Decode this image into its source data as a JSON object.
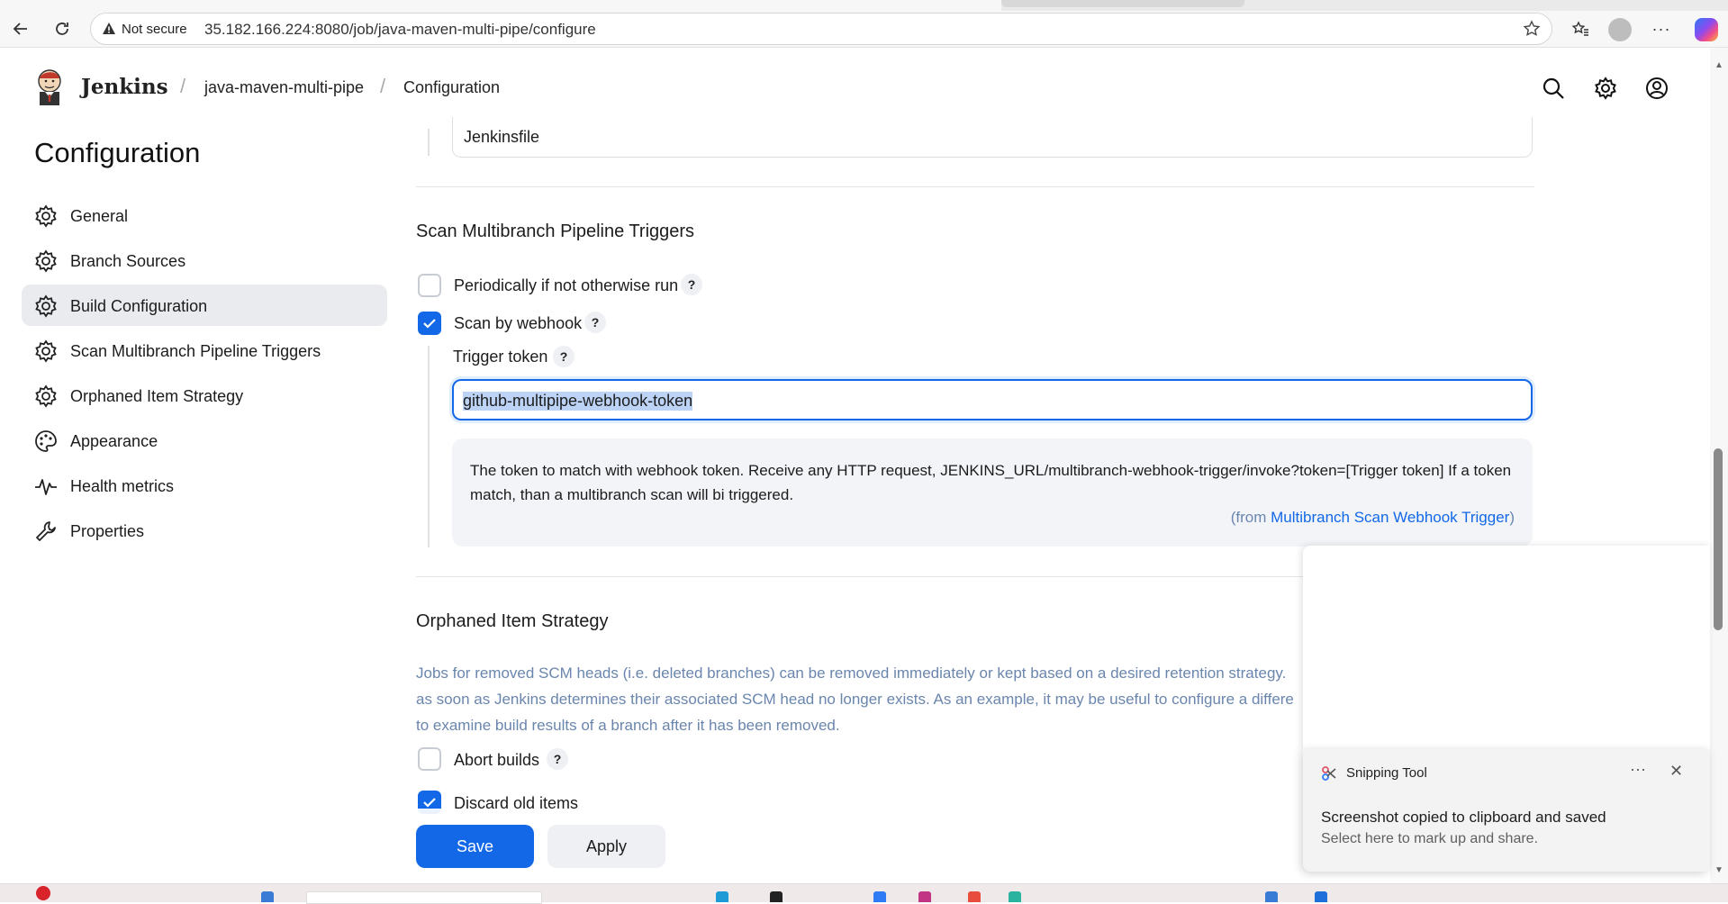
{
  "browser": {
    "security_label": "Not secure",
    "url": "35.182.166.224:8080/job/java-maven-multi-pipe/configure"
  },
  "header": {
    "brand": "Jenkins",
    "breadcrumbs": [
      "java-maven-multi-pipe",
      "Configuration"
    ]
  },
  "sidebar": {
    "title": "Configuration",
    "items": [
      {
        "label": "General",
        "icon": "gear-icon"
      },
      {
        "label": "Branch Sources",
        "icon": "gear-icon"
      },
      {
        "label": "Build Configuration",
        "icon": "gear-icon",
        "active": true
      },
      {
        "label": "Scan Multibranch Pipeline Triggers",
        "icon": "gear-icon"
      },
      {
        "label": "Orphaned Item Strategy",
        "icon": "gear-icon"
      },
      {
        "label": "Appearance",
        "icon": "palette-icon"
      },
      {
        "label": "Health metrics",
        "icon": "pulse-icon"
      },
      {
        "label": "Properties",
        "icon": "wrench-icon"
      }
    ]
  },
  "main": {
    "script_path_value": "Jenkinsfile",
    "triggers": {
      "title": "Scan Multibranch Pipeline Triggers",
      "periodic_label": "Periodically if not otherwise run",
      "periodic_checked": false,
      "webhook_label": "Scan by webhook",
      "webhook_checked": true,
      "token_label": "Trigger token",
      "token_value": "github-multipipe-webhook-token",
      "help_text": "The token to match with webhook token. Receive any HTTP request, JENKINS_URL/multibranch-webhook-trigger/invoke?token=[Trigger token] If a token match, than a multibranch scan will bi triggered.",
      "help_from_prefix": "(from ",
      "help_from_link": "Multibranch Scan Webhook Trigger",
      "help_from_suffix": ")"
    },
    "orphaned": {
      "title": "Orphaned Item Strategy",
      "desc_lines": [
        "Jobs for removed SCM heads (i.e. deleted branches) can be removed immediately or kept based on a desired retention strategy.",
        "as soon as Jenkins determines their associated SCM head no longer exists. As an example, it may be useful to configure a differe",
        "to examine build results of a branch after it has been removed."
      ],
      "abort_label": "Abort builds",
      "abort_checked": false,
      "discard_label": "Discard old items",
      "discard_checked": true
    },
    "help_mark": "?"
  },
  "buttons": {
    "save": "Save",
    "apply": "Apply"
  },
  "toast": {
    "app": "Snipping Tool",
    "more": "···",
    "close": "✕",
    "title": "Screenshot copied to clipboard and saved",
    "subtitle": "Select here to mark up and share."
  },
  "colors": {
    "accent": "#1368e8",
    "description_text": "#6a86ad"
  }
}
